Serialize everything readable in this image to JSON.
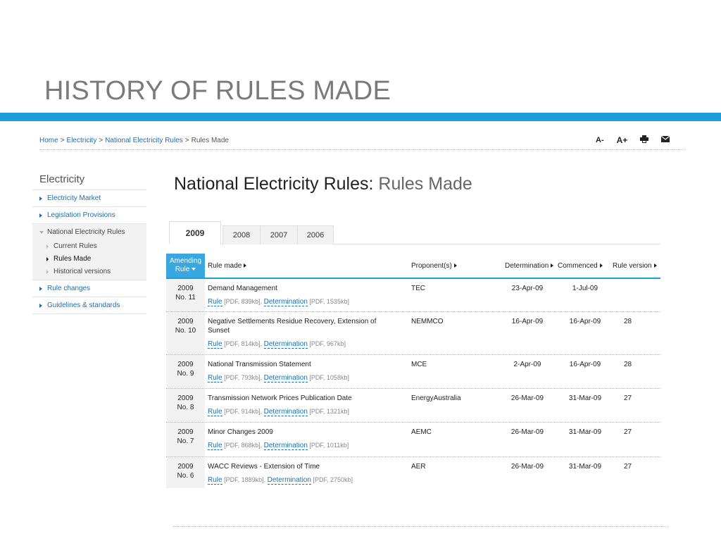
{
  "slide_title": "HISTORY OF RULES MADE",
  "breadcrumb": {
    "home": "Home",
    "electricity": "Electricity",
    "ner": "National Electricity Rules",
    "current": "Rules Made",
    "separator": ">"
  },
  "toolbar": {
    "decrease_font": "A-",
    "increase_font": "A+",
    "print_icon": "print-icon",
    "email_icon": "email-icon"
  },
  "sidebar": {
    "title": "Electricity",
    "items": [
      {
        "label": "Electricity Market"
      },
      {
        "label": "Legislation Provisions"
      }
    ],
    "group": {
      "label": "National Electricity Rules",
      "children": [
        {
          "label": "Current Rules",
          "active": false
        },
        {
          "label": "Rules Made",
          "active": true
        },
        {
          "label": "Historical versions",
          "active": false
        }
      ]
    },
    "items_after": [
      {
        "label": "Rule changes"
      },
      {
        "label": "Guidelines & standards"
      }
    ]
  },
  "heading": {
    "main": "National Electricity Rules:",
    "sub": "Rules Made"
  },
  "tabs": [
    {
      "label": "2009",
      "active": true
    },
    {
      "label": "2008",
      "active": false
    },
    {
      "label": "2007",
      "active": false
    },
    {
      "label": "2006",
      "active": false
    }
  ],
  "table": {
    "headers": {
      "amending_line1": "Amending",
      "amending_line2": "Rule",
      "rule_made": "Rule made",
      "proponent": "Proponent(s)",
      "determination": "Determination",
      "commenced": "Commenced",
      "rule_version": "Rule version"
    },
    "rows": [
      {
        "year": "2009",
        "no": "No. 11",
        "title": "Demand Management",
        "rule_size": "[PDF, 839kb],",
        "det_size": "[PDF, 1535kb]",
        "proponent": "TEC",
        "determination": "23-Apr-09",
        "commenced": "1-Jul-09",
        "version": ""
      },
      {
        "year": "2009",
        "no": "No. 10",
        "title": "Negative Settlements Residue Recovery, Extension of Sunset",
        "rule_size": "[PDF, 814kb],",
        "det_size": "[PDF, 967kb]",
        "proponent": "NEMMCO",
        "determination": "16-Apr-09",
        "commenced": "16-Apr-09",
        "version": "28"
      },
      {
        "year": "2009",
        "no": "No. 9",
        "title": "National Transmission Statement",
        "rule_size": "[PDF, 793kb],",
        "det_size": "[PDF, 1058kb]",
        "proponent": "MCE",
        "determination": "2-Apr-09",
        "commenced": "16-Apr-09",
        "version": "28"
      },
      {
        "year": "2009",
        "no": "No. 8",
        "title": "Transmission Network Prices Publication Date",
        "rule_size": "[PDF, 914kb],",
        "det_size": "[PDF, 1321kb]",
        "proponent": "EnergyAustralia",
        "determination": "26-Mar-09",
        "commenced": "31-Mar-09",
        "version": "27"
      },
      {
        "year": "2009",
        "no": "No. 7",
        "title": "Minor Changes 2009",
        "rule_size": "[PDF, 868kb],",
        "det_size": "[PDF, 1011kb]",
        "proponent": "AEMC",
        "determination": "26-Mar-09",
        "commenced": "31-Mar-09",
        "version": "27"
      },
      {
        "year": "2009",
        "no": "No. 6",
        "title": "WACC Reviews - Extension of Time",
        "rule_size": "[PDF, 1889kb],",
        "det_size": "[PDF, 2750kb]",
        "proponent": "AER",
        "determination": "26-Mar-09",
        "commenced": "31-Mar-09",
        "version": "27"
      }
    ],
    "link_rule": "Rule",
    "link_determination": "Determination"
  },
  "colors": {
    "accent": "#1b9fdc",
    "link": "#1b6fb5"
  }
}
